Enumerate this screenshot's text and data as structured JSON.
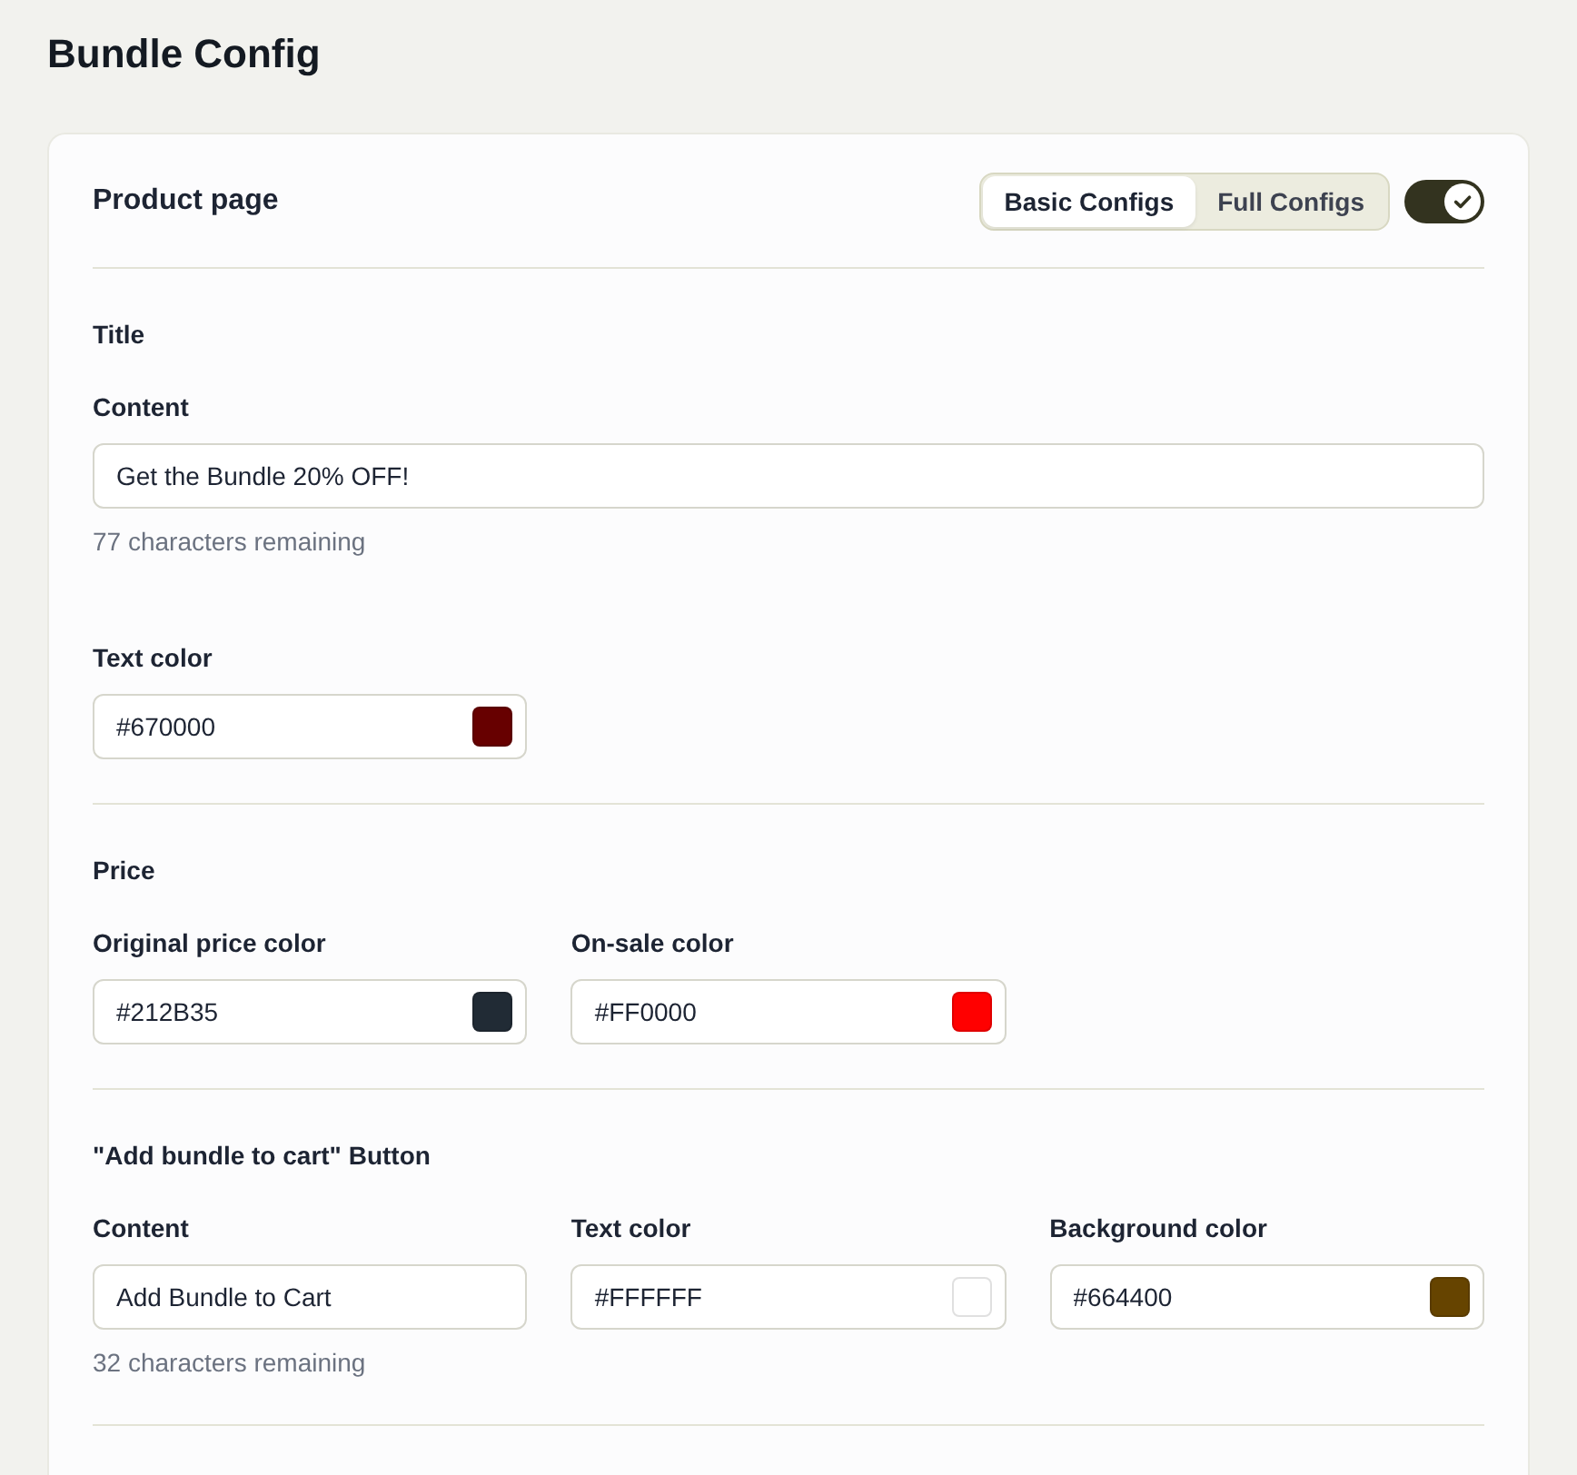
{
  "page": {
    "title": "Bundle Config"
  },
  "card": {
    "title": "Product page",
    "mode_tabs": [
      {
        "label": "Basic Configs",
        "selected": true
      },
      {
        "label": "Full Configs",
        "selected": false
      }
    ],
    "enabled": true
  },
  "sections": [
    {
      "title": "Title",
      "rows": [
        [
          {
            "kind": "text",
            "label": "Content",
            "value": "Get the Bundle 20% OFF!",
            "helper": "77 characters remaining"
          }
        ],
        [
          {
            "kind": "color",
            "label": "Text color",
            "value": "#670000",
            "color": "#670000"
          }
        ]
      ]
    },
    {
      "title": "Price",
      "rows": [
        [
          {
            "kind": "color",
            "label": "Original price color",
            "value": "#212B35",
            "color": "#212b35"
          },
          {
            "kind": "color",
            "label": "On-sale color",
            "value": "#FF0000",
            "color": "#ff0000"
          }
        ]
      ]
    },
    {
      "title": "\"Add bundle to cart\" Button",
      "rows": [
        [
          {
            "kind": "text",
            "label": "Content",
            "value": "Add Bundle to Cart",
            "helper": "32 characters remaining"
          },
          {
            "kind": "color",
            "label": "Text color",
            "value": "#FFFFFF",
            "color": "#ffffff"
          },
          {
            "kind": "color",
            "label": "Background color",
            "value": "#664400",
            "color": "#664400"
          }
        ]
      ]
    }
  ]
}
